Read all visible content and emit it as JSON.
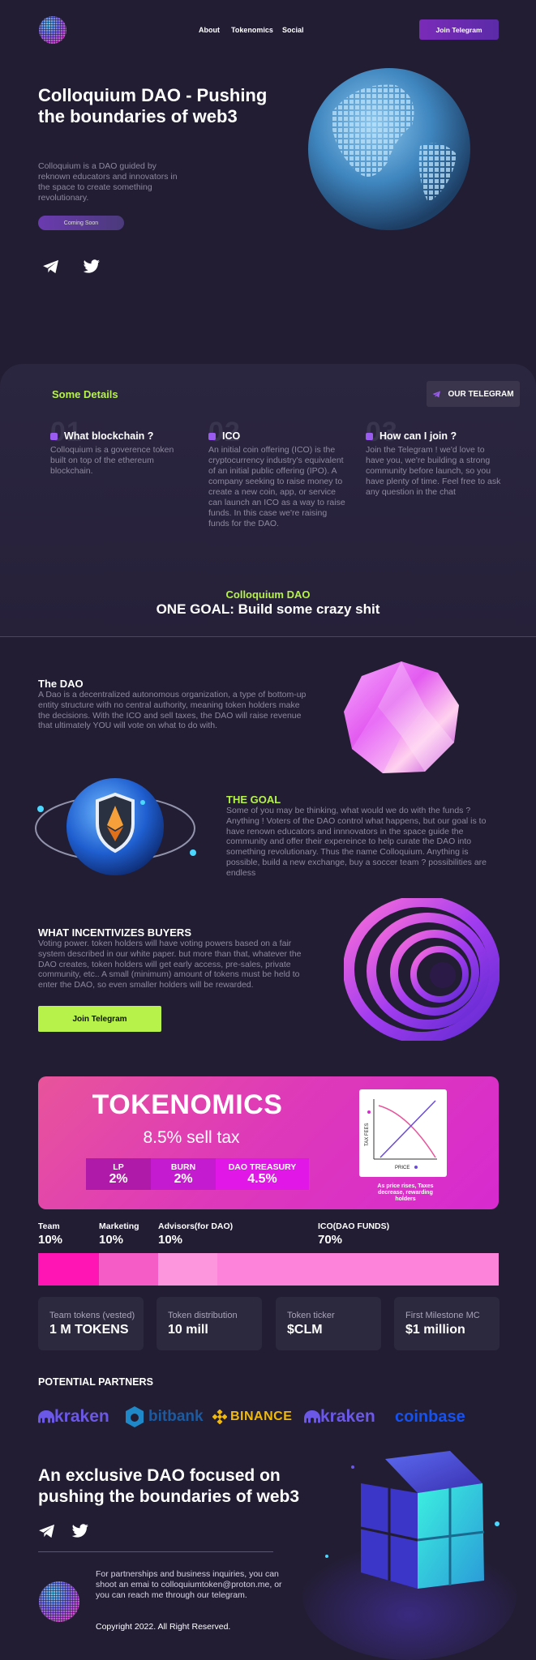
{
  "nav": {
    "items": [
      "About",
      "Tokenomics",
      "Social"
    ],
    "cta": "Join Telegram"
  },
  "hero": {
    "title": "Colloquium DAO - Pushing the boundaries of web3",
    "text": "Colloquium is a DAO guided by reknown educators and innovators in the space to create something revolutionary.",
    "button": "Coming Soon"
  },
  "details": {
    "title": "Some Details",
    "telegram_button": "OUR TELEGRAM",
    "steps": [
      {
        "num": "01",
        "title": "What blockchain ?",
        "text": "Colloquium is a goverence token built on top of the ethereum blockchain."
      },
      {
        "num": "02",
        "title": "ICO",
        "text": "An initial coin offering (ICO) is the cryptocurrency industry's equivalent of an initial public offering (IPO). A company seeking to raise money to create a new coin, app, or service can launch an ICO as a way to raise funds. In this case we're raising funds for the DAO."
      },
      {
        "num": "03",
        "title": "How can I join ?",
        "text": "Join the Telegram ! we'd love to have you, we're building a strong community before launch, so you have plenty of time. Feel free to ask any question in the chat"
      }
    ]
  },
  "goal_banner": {
    "kicker": "Colloquium DAO",
    "headline": "ONE GOAL: Build some crazy shit"
  },
  "sections": {
    "dao": {
      "title": "The DAO",
      "text": "A Dao is a decentralized autonomous organization, a type of bottom-up entity structure with no central authority, meaning token holders make the decisions. With the ICO and sell taxes, the DAO will raise revenue that ultimately YOU will vote on what to do with."
    },
    "goal": {
      "title": "THE GOAL",
      "text": "Some of you may be thinking, what would we do with the funds ? Anything ! Voters of the DAO control what happens, but our goal is to have renown educators and innnovators in the space guide the community and offer their expereince to help curate the DAO into something revolutionary. Thus the name Colloquium. Anything is possible, build a new exchange, buy a soccer team ? possibilities are endless"
    },
    "incentives": {
      "title": "WHAT INCENTIVIZES BUYERS",
      "text": "Voting power. token holders will have voting powers based on a fair system described in our white paper. but more than that, whatever the DAO creates, token holders will get early access, pre-sales, private community, etc.. A small (minimum) amount of tokens must be held to enter the DAO, so even smaller holders will be rewarded.",
      "button": "Join Telegram"
    }
  },
  "tokenomics": {
    "title": "TOKENOMICS",
    "sell_tax": "8.5% sell tax",
    "taxes": [
      {
        "label": "LP",
        "value": "2%",
        "color": "#b01aa8"
      },
      {
        "label": "BURN",
        "value": "2%",
        "color": "#c51bd0"
      },
      {
        "label": "DAO TREASURY",
        "value": "4.5%",
        "color": "#e117e8"
      }
    ],
    "graph": {
      "ylabel": "TAX FEES",
      "xlabel": "PRICE"
    },
    "graph_caption": "As price rises, Taxes decrease, rewarding holders",
    "allocation": [
      {
        "label": "Team",
        "pct": "10%",
        "share": 10,
        "color": "#ff14b4"
      },
      {
        "label": "Marketing",
        "pct": "10%",
        "share": 10,
        "color": "#f65cc6"
      },
      {
        "label": "Advisors(for DAO)",
        "pct": "10%",
        "share": 10,
        "color": "#fd96dc"
      },
      {
        "label": "ICO(DAO FUNDS)",
        "pct": "70%",
        "share": 70,
        "color": "#fd82da"
      }
    ],
    "stats": [
      {
        "key": "Team tokens (vested)",
        "value": "1 M TOKENS"
      },
      {
        "key": "Token distribution",
        "value": "10 mill"
      },
      {
        "key": "Token ticker",
        "value": "$CLM"
      },
      {
        "key": "First Milestone MC",
        "value": "$1 million"
      }
    ]
  },
  "partners": {
    "title": "POTENTIAL PARTNERS",
    "logos": [
      "kraken",
      "bitbank",
      "BINANCE",
      "kraken",
      "coinbase"
    ]
  },
  "footer": {
    "title": "An exclusive DAO focused on pushing the boundaries of web3",
    "text": "For partnerships and business inquiries, you can shoot an emai to colloquiumtoken@proton.me, or you can reach me through our telegram.",
    "copyright": "Copyright 2022. All Right Reserved."
  },
  "colors": {
    "background": "#221d33",
    "accent_green": "#b6f24a",
    "accent_purple": "#7a2bb8",
    "muted_text": "#8e889f"
  }
}
